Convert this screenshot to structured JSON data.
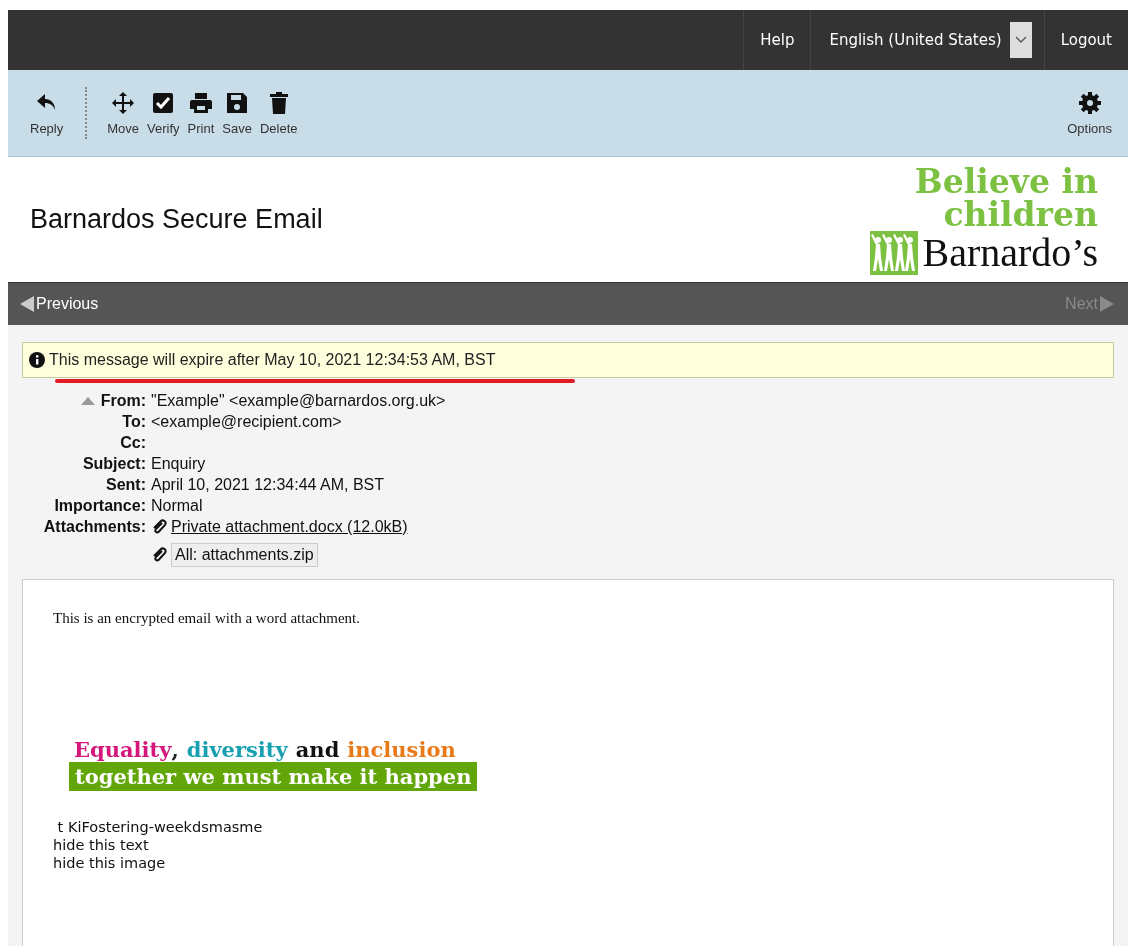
{
  "top_bar": {
    "links": [
      {
        "kind": "link",
        "label": "Help"
      },
      {
        "kind": "dropdown",
        "label": "English (United States)"
      },
      {
        "kind": "link",
        "label": "Logout"
      }
    ]
  },
  "toolbar": {
    "actions": [
      {
        "kind": "reply",
        "label": "Reply"
      },
      {
        "kind": "move",
        "label": "Move"
      },
      {
        "kind": "verify",
        "label": "Verify"
      },
      {
        "kind": "print",
        "label": "Print"
      },
      {
        "kind": "save",
        "label": "Save"
      },
      {
        "kind": "delete",
        "label": "Delete"
      }
    ],
    "options": {
      "label": "Options"
    }
  },
  "header": {
    "title": "Barnardos Secure Email",
    "logo": {
      "tagline_lines": [
        "Believe in",
        "children"
      ],
      "name": "Barnardo’s"
    }
  },
  "nav": {
    "previous": {
      "label": "Previous",
      "disabled": false
    },
    "next": {
      "label": "Next",
      "disabled": true
    }
  },
  "notice": {
    "text": "This message will expire after May 10, 2021 12:34:53 AM, BST",
    "underlined": true
  },
  "headers": {
    "expanded": true,
    "fields": [
      {
        "label": "From:",
        "value": "\"Example\" <example@barnardos.org.uk>"
      },
      {
        "label": "To:",
        "value": "<example@recipient.com>"
      },
      {
        "label": "Cc:"
      },
      {
        "label": "Subject:",
        "value": "Enquiry"
      },
      {
        "label": "Sent:",
        "value": "April 10, 2021 12:34:44 AM, BST"
      },
      {
        "label": "Importance:",
        "value": "Normal"
      }
    ],
    "attachments": {
      "label": "Attachments:",
      "files": [
        {
          "kind": "link",
          "name": "Private attachment.docx (12.0kB)"
        },
        {
          "kind": "bundle",
          "name": "All: attachments.zip"
        }
      ]
    }
  },
  "body": {
    "intro": "This is an encrypted email with a word attachment.",
    "banner": {
      "words": [
        {
          "text": "Equality",
          "color": "#d4177a"
        },
        {
          "text": ",",
          "color": "#222222"
        },
        {
          "text": "diversity",
          "color": "#17a0b0"
        },
        {
          "text": "and",
          "color": "#111111"
        },
        {
          "text": "inclusion",
          "color": "#e87a1a"
        }
      ],
      "slogan": "together we must make it happen"
    },
    "lines": [
      " t KiFostering-weekdsmasme",
      "hide this text",
      "hide this image"
    ]
  }
}
